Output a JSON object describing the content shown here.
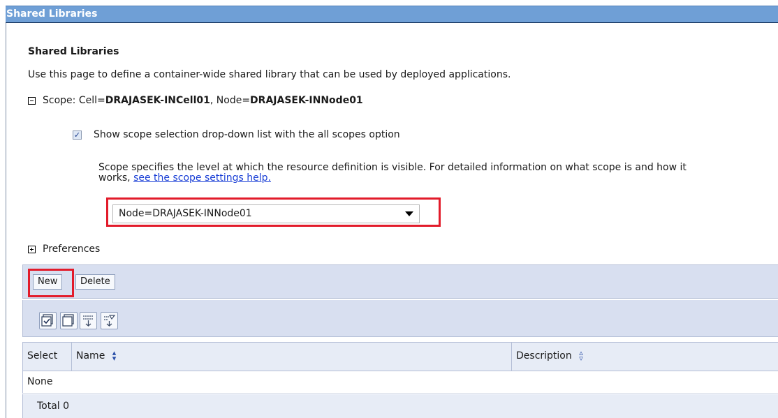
{
  "window": {
    "title": "Shared Libraries"
  },
  "main": {
    "heading": "Shared Libraries",
    "description": "Use this page to define a container-wide shared library that can be used by deployed applications.",
    "scope": {
      "prefix": "Scope: Cell=",
      "cell": "DRAJASEK-INCell01",
      "node_prefix": ", Node=",
      "node": "DRAJASEK-INNode01"
    },
    "show_scope_checkbox": {
      "label": "Show scope selection drop-down list with the all scopes option",
      "checked": true
    },
    "scope_help": {
      "text": "Scope specifies the level at which the resource definition is visible. For detailed information on what scope is and how it works,",
      "link": "see the scope settings help."
    },
    "scope_select": {
      "value": "Node=DRAJASEK-INNode01"
    },
    "preferences": "Preferences"
  },
  "toolbar": {
    "new_label": "New",
    "delete_label": "Delete",
    "icons": [
      "select-all-icon",
      "deselect-all-icon",
      "show-filter-icon",
      "clear-filter-icon"
    ]
  },
  "table": {
    "columns": [
      "Select",
      "Name",
      "Description"
    ],
    "empty_text": "None",
    "total": "Total 0"
  },
  "colors": {
    "title_bar": "#6f9fd6",
    "highlight": "#e21b2a",
    "toolbar": "#d8dff0"
  }
}
